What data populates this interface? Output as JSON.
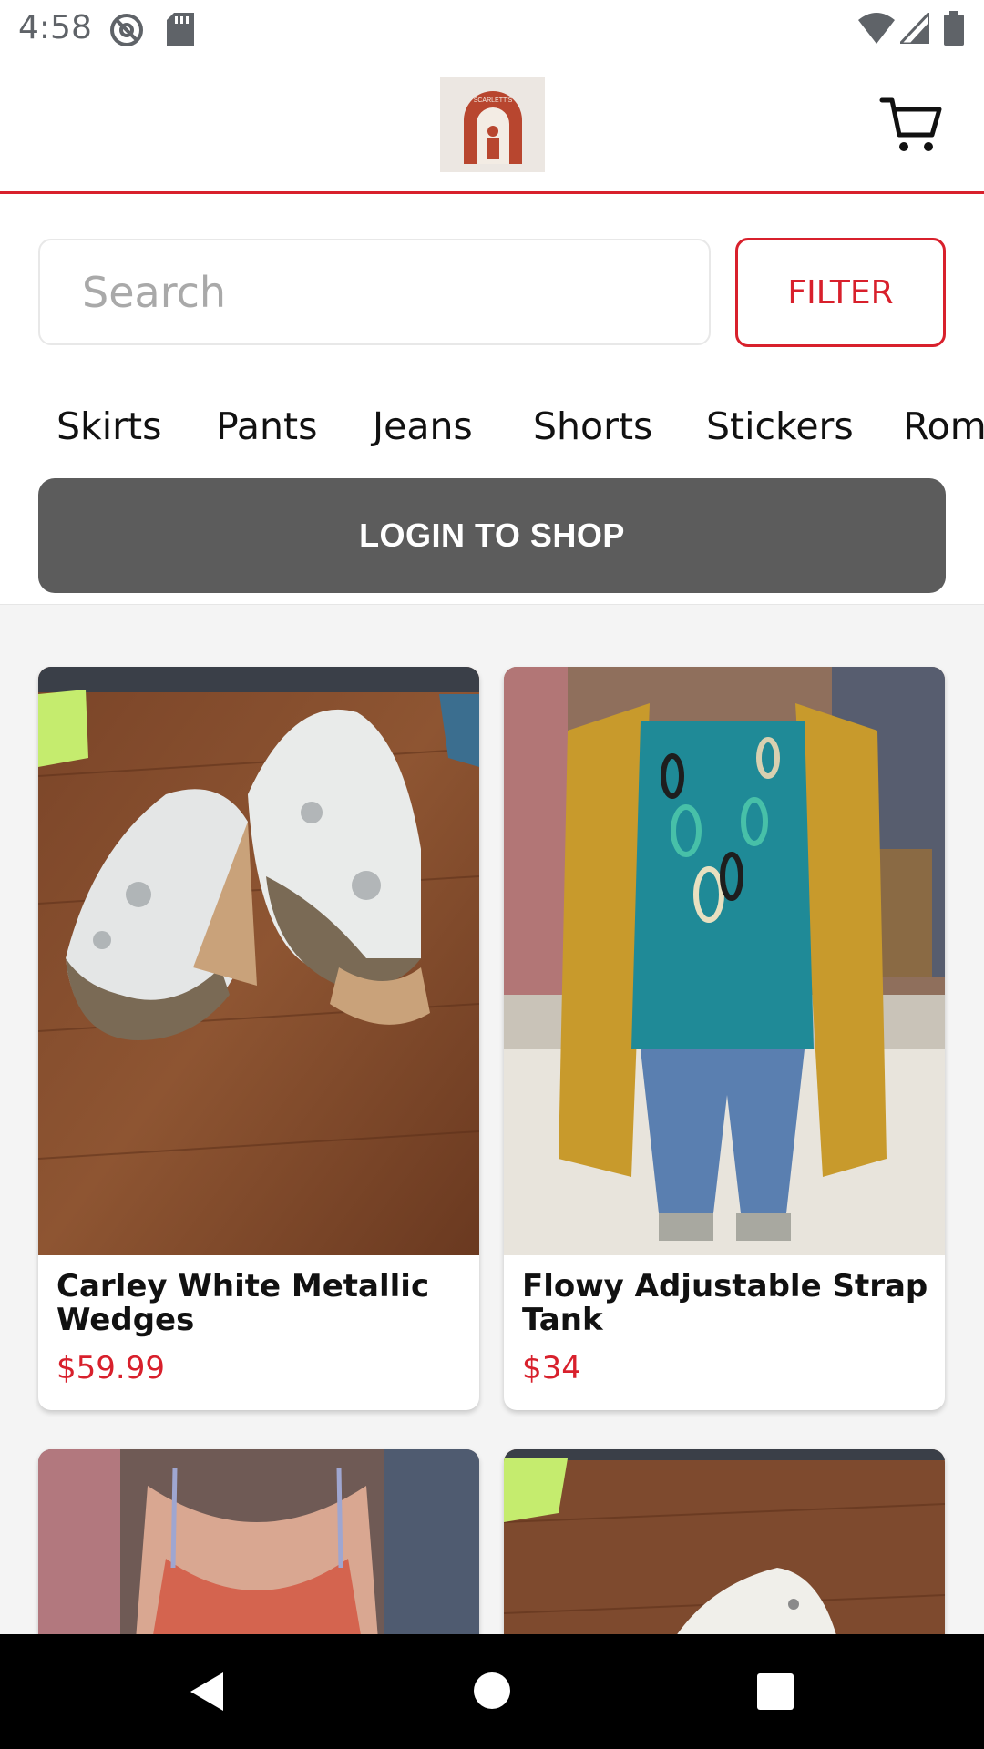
{
  "status_bar": {
    "time": "4:58",
    "icons": [
      "at-sign-icon",
      "sd-card-icon",
      "wifi-icon",
      "signal-icon",
      "battery-icon"
    ]
  },
  "header": {
    "logo_text": "SCARLETT'S BOUTIQUE & HOME",
    "cart_icon": "cart-icon"
  },
  "search": {
    "placeholder": "Search"
  },
  "filter_button": {
    "label": "FILTER"
  },
  "categories": [
    "Skirts",
    "Pants",
    "Jeans",
    "Shorts",
    "Stickers",
    "Rom"
  ],
  "login_button": {
    "label": "LOGIN TO SHOP"
  },
  "products": [
    {
      "title": "Carley White Metallic Wedges",
      "price": "$59.99"
    },
    {
      "title": "Flowy Adjustable Strap Tank",
      "price": "$34"
    },
    {
      "title": "",
      "price": ""
    },
    {
      "title": "",
      "price": ""
    }
  ],
  "colors": {
    "accent": "#d8202c",
    "login_bg": "#5c5c5c",
    "page_bg": "#f4f4f4"
  }
}
